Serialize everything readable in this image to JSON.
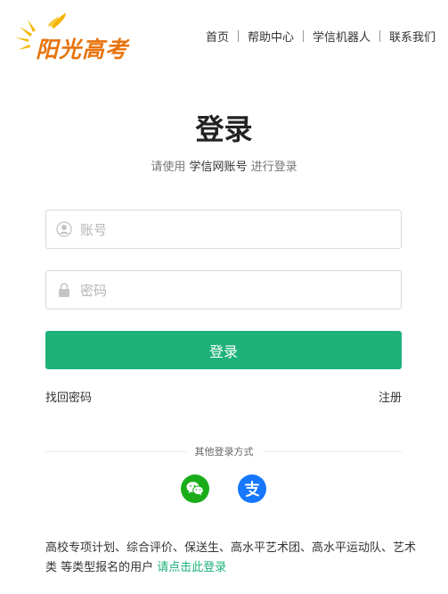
{
  "brand": {
    "logo_text": "阳光高考",
    "logo_color": "#e8730c"
  },
  "nav": {
    "items": [
      {
        "label": "首页"
      },
      {
        "label": "帮助中心"
      },
      {
        "label": "学信机器人"
      },
      {
        "label": "联系我们"
      }
    ]
  },
  "login": {
    "title": "登录",
    "subtitle_prefix": "请使用",
    "subtitle_account": "学信网账号",
    "subtitle_suffix": "进行登录",
    "username_placeholder": "账号",
    "password_placeholder": "密码",
    "submit_label": "登录",
    "forgot_password": "找回密码",
    "register": "注册",
    "other_methods_label": "其他登录方式",
    "methods": [
      {
        "icon": "wechat-icon",
        "color": "#1aad19"
      },
      {
        "icon": "alipay-icon",
        "color": "#1677ff"
      }
    ],
    "accent_color": "#1db179"
  },
  "footer": {
    "text": "高校专项计划、综合评价、保送生、高水平艺术团、高水平运动队、艺术类 等类型报名的用户",
    "link": "请点击此登录"
  }
}
